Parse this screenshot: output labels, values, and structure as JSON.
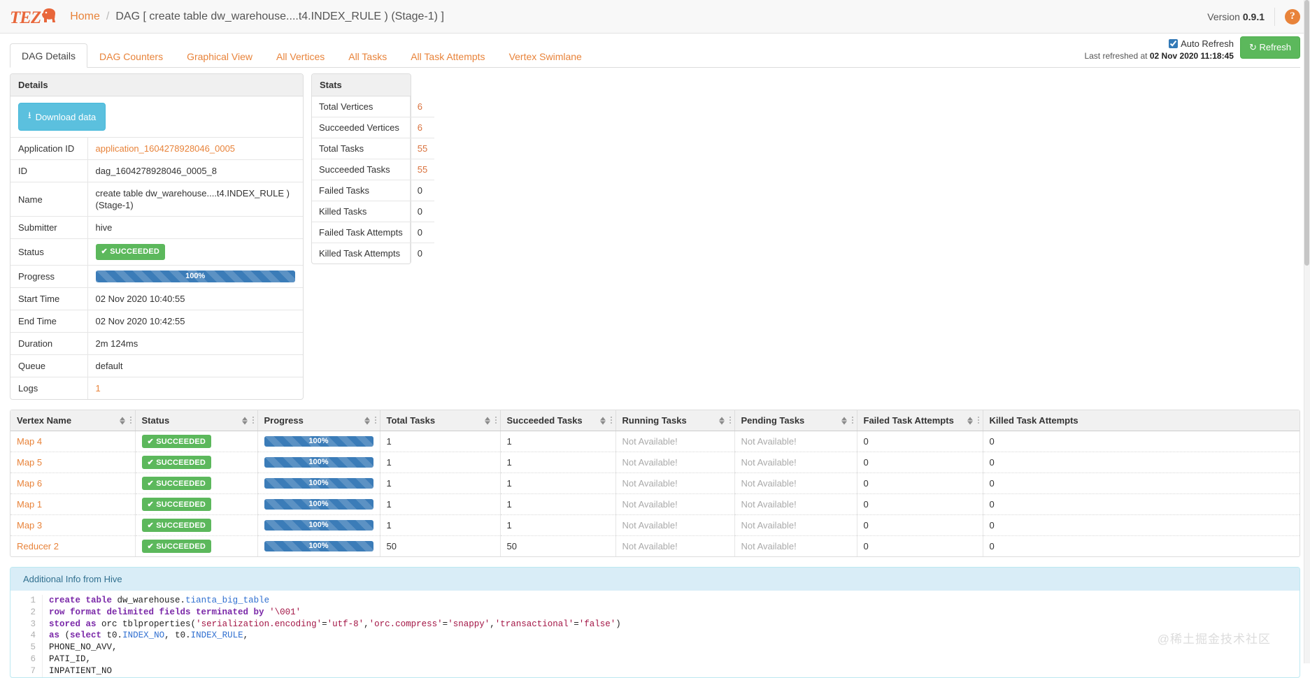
{
  "navbar": {
    "logo_text": "TEZ",
    "logo_icon": "elephant-icon",
    "breadcrumb_home": "Home",
    "breadcrumb_sep": "/",
    "breadcrumb_current": "DAG [ create table dw_warehouse....t4.INDEX_RULE ) (Stage-1) ]",
    "version_label": "Version",
    "version_value": "0.9.1",
    "help_icon": "question-mark-icon"
  },
  "tabs": [
    {
      "label": "DAG Details",
      "active": true
    },
    {
      "label": "DAG Counters",
      "active": false
    },
    {
      "label": "Graphical View",
      "active": false
    },
    {
      "label": "All Vertices",
      "active": false
    },
    {
      "label": "All Tasks",
      "active": false
    },
    {
      "label": "All Task Attempts",
      "active": false
    },
    {
      "label": "Vertex Swimlane",
      "active": false
    }
  ],
  "refresh": {
    "auto_refresh_label": "Auto Refresh",
    "auto_refresh_checked": true,
    "last_refreshed_prefix": "Last refreshed at",
    "last_refreshed_time": "02 Nov 2020 11:18:45",
    "refresh_button": "Refresh",
    "refresh_icon": "refresh-icon"
  },
  "details": {
    "title": "Details",
    "download_button": "Download data",
    "download_icon": "download-icon",
    "rows": [
      {
        "key": "Application ID",
        "value": "application_1604278928046_0005",
        "type": "link"
      },
      {
        "key": "ID",
        "value": "dag_1604278928046_0005_8",
        "type": "text"
      },
      {
        "key": "Name",
        "value": "create table dw_warehouse....t4.INDEX_RULE ) (Stage-1)",
        "type": "text"
      },
      {
        "key": "Submitter",
        "value": "hive",
        "type": "text"
      },
      {
        "key": "Status",
        "value": "SUCCEEDED",
        "type": "badge"
      },
      {
        "key": "Progress",
        "value": "100%",
        "type": "progress"
      },
      {
        "key": "Start Time",
        "value": "02 Nov 2020 10:40:55",
        "type": "text"
      },
      {
        "key": "End Time",
        "value": "02 Nov 2020 10:42:55",
        "type": "text"
      },
      {
        "key": "Duration",
        "value": "2m 124ms",
        "type": "text"
      },
      {
        "key": "Queue",
        "value": "default",
        "type": "text"
      },
      {
        "key": "Logs",
        "value": "1",
        "type": "link"
      }
    ]
  },
  "stats": {
    "title": "Stats",
    "rows": [
      {
        "key": "Total Vertices",
        "value": "6",
        "highlight": true
      },
      {
        "key": "Succeeded Vertices",
        "value": "6",
        "highlight": true
      },
      {
        "key": "Total Tasks",
        "value": "55",
        "highlight": true
      },
      {
        "key": "Succeeded Tasks",
        "value": "55",
        "highlight": true
      },
      {
        "key": "Failed Tasks",
        "value": "0",
        "highlight": false
      },
      {
        "key": "Killed Tasks",
        "value": "0",
        "highlight": false
      },
      {
        "key": "Failed Task Attempts",
        "value": "0",
        "highlight": false
      },
      {
        "key": "Killed Task Attempts",
        "value": "0",
        "highlight": false
      }
    ]
  },
  "vertices_table": {
    "columns": [
      "Vertex Name",
      "Status",
      "Progress",
      "Total Tasks",
      "Succeeded Tasks",
      "Running Tasks",
      "Pending Tasks",
      "Failed Task Attempts",
      "Killed Task Attempts"
    ],
    "rows": [
      {
        "name": "Map 4",
        "status": "SUCCEEDED",
        "progress": "100%",
        "total_tasks": "1",
        "succeeded_tasks": "1",
        "running_tasks": "Not Available!",
        "pending_tasks": "Not Available!",
        "failed_task_attempts": "0",
        "killed_task_attempts": "0"
      },
      {
        "name": "Map 5",
        "status": "SUCCEEDED",
        "progress": "100%",
        "total_tasks": "1",
        "succeeded_tasks": "1",
        "running_tasks": "Not Available!",
        "pending_tasks": "Not Available!",
        "failed_task_attempts": "0",
        "killed_task_attempts": "0"
      },
      {
        "name": "Map 6",
        "status": "SUCCEEDED",
        "progress": "100%",
        "total_tasks": "1",
        "succeeded_tasks": "1",
        "running_tasks": "Not Available!",
        "pending_tasks": "Not Available!",
        "failed_task_attempts": "0",
        "killed_task_attempts": "0"
      },
      {
        "name": "Map 1",
        "status": "SUCCEEDED",
        "progress": "100%",
        "total_tasks": "1",
        "succeeded_tasks": "1",
        "running_tasks": "Not Available!",
        "pending_tasks": "Not Available!",
        "failed_task_attempts": "0",
        "killed_task_attempts": "0"
      },
      {
        "name": "Map 3",
        "status": "SUCCEEDED",
        "progress": "100%",
        "total_tasks": "1",
        "succeeded_tasks": "1",
        "running_tasks": "Not Available!",
        "pending_tasks": "Not Available!",
        "failed_task_attempts": "0",
        "killed_task_attempts": "0"
      },
      {
        "name": "Reducer 2",
        "status": "SUCCEEDED",
        "progress": "100%",
        "total_tasks": "50",
        "succeeded_tasks": "50",
        "running_tasks": "Not Available!",
        "pending_tasks": "Not Available!",
        "failed_task_attempts": "0",
        "killed_task_attempts": "0"
      }
    ]
  },
  "hive_info": {
    "title": "Additional Info from Hive",
    "lines": [
      {
        "n": "1",
        "tokens": [
          {
            "t": "create table ",
            "c": "kw"
          },
          {
            "t": "dw_warehouse.",
            "c": ""
          },
          {
            "t": "tianta_big_table",
            "c": "id"
          }
        ]
      },
      {
        "n": "2",
        "tokens": [
          {
            "t": "row format delimited fields terminated by ",
            "c": "kw"
          },
          {
            "t": "'\\001'",
            "c": "st"
          }
        ]
      },
      {
        "n": "3",
        "tokens": [
          {
            "t": "stored as ",
            "c": "kw"
          },
          {
            "t": "orc tblproperties",
            "c": ""
          },
          {
            "t": "(",
            "c": ""
          },
          {
            "t": "'serialization.encoding'",
            "c": "st"
          },
          {
            "t": "=",
            "c": ""
          },
          {
            "t": "'utf-8'",
            "c": "st"
          },
          {
            "t": ",",
            "c": ""
          },
          {
            "t": "'orc.compress'",
            "c": "st"
          },
          {
            "t": "=",
            "c": ""
          },
          {
            "t": "'snappy'",
            "c": "st"
          },
          {
            "t": ",",
            "c": ""
          },
          {
            "t": "'transactional'",
            "c": "st"
          },
          {
            "t": "=",
            "c": ""
          },
          {
            "t": "'false'",
            "c": "st"
          },
          {
            "t": ")",
            "c": ""
          }
        ]
      },
      {
        "n": "4",
        "tokens": [
          {
            "t": "as ",
            "c": "kw"
          },
          {
            "t": "(",
            "c": ""
          },
          {
            "t": "select",
            "c": "kw"
          },
          {
            "t": " t0.",
            "c": ""
          },
          {
            "t": "INDEX_NO",
            "c": "id"
          },
          {
            "t": ", t0.",
            "c": ""
          },
          {
            "t": "INDEX_RULE",
            "c": "id"
          },
          {
            "t": ",",
            "c": ""
          }
        ]
      },
      {
        "n": "5",
        "tokens": [
          {
            "t": "PHONE_NO_AVV,",
            "c": ""
          }
        ]
      },
      {
        "n": "6",
        "tokens": [
          {
            "t": "PATI_ID,",
            "c": ""
          }
        ]
      },
      {
        "n": "7",
        "tokens": [
          {
            "t": "INPATIENT_NO",
            "c": ""
          }
        ]
      }
    ]
  },
  "watermark": "@稀土掘金技术社区"
}
